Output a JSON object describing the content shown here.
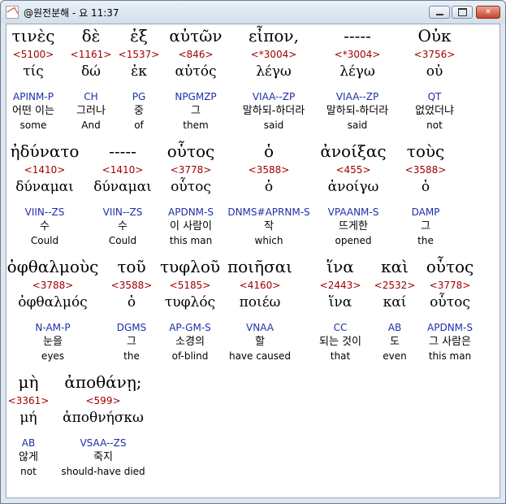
{
  "window": {
    "title": "@원전분해 - 요 11:37",
    "icon": "app-icon"
  },
  "rows": [
    {
      "words": [
        {
          "greek": "τινὲς",
          "strong": "<5100>",
          "lemma": "τίς",
          "parse": "APINM-P",
          "korean": "어떤 이는",
          "english": "some"
        },
        {
          "greek": "δὲ",
          "strong": "<1161>",
          "lemma": "δώ",
          "parse": "CH",
          "korean": "그러나",
          "english": "And"
        },
        {
          "greek": "ἐξ",
          "strong": "<1537>",
          "lemma": "ἐκ",
          "parse": "PG",
          "korean": "중",
          "english": "of"
        },
        {
          "greek": "αὐτῶν",
          "strong": "<846>",
          "lemma": "αὐτός",
          "parse": "NPGMZP",
          "korean": "그",
          "english": "them"
        },
        {
          "greek": "εἶπον,",
          "strong": "<*3004>",
          "lemma": "λέγω",
          "parse": "VIAA--ZP",
          "korean": "말하되-하더라",
          "english": "said"
        },
        {
          "greek": "-----",
          "strong": "<*3004>",
          "lemma": "λέγω",
          "parse": "VIAA--ZP",
          "korean": "말하되-하더라",
          "english": "said"
        },
        {
          "greek": "Οὐκ",
          "strong": "<3756>",
          "lemma": "οὐ",
          "parse": "QT",
          "korean": "없었더냐",
          "english": "not"
        }
      ]
    },
    {
      "words": [
        {
          "greek": "ἠδύνατο",
          "strong": "<1410>",
          "lemma": "δύναμαι",
          "parse": "VIIN--ZS",
          "korean": "수",
          "english": "Could"
        },
        {
          "greek": "-----",
          "strong": "<1410>",
          "lemma": "δύναμαι",
          "parse": "VIIN--ZS",
          "korean": "수",
          "english": "Could"
        },
        {
          "greek": "οὗτος",
          "strong": "<3778>",
          "lemma": "οὗτος",
          "parse": "APDNM-S",
          "korean": "이 사람이",
          "english": "this man"
        },
        {
          "greek": "ὁ",
          "strong": "<3588>",
          "lemma": "ὁ",
          "parse": "DNMS#APRNM-S",
          "korean": "작",
          "english": "which"
        },
        {
          "greek": "ἀνοίξας",
          "strong": "<455>",
          "lemma": "ἀνοίγω",
          "parse": "VPAANM-S",
          "korean": "뜨게한",
          "english": "opened"
        },
        {
          "greek": "τοὺς",
          "strong": "<3588>",
          "lemma": "ὁ",
          "parse": "DAMP",
          "korean": "그",
          "english": "the"
        }
      ]
    },
    {
      "words": [
        {
          "greek": "ὀφθαλμοὺς",
          "strong": "<3788>",
          "lemma": "ὀφθαλμός",
          "parse": "N-AM-P",
          "korean": "눈을",
          "english": "eyes"
        },
        {
          "greek": "τοῦ",
          "strong": "<3588>",
          "lemma": "ὁ",
          "parse": "DGMS",
          "korean": "그",
          "english": "the"
        },
        {
          "greek": "τυφλοῦ",
          "strong": "<5185>",
          "lemma": "τυφλός",
          "parse": "AP-GM-S",
          "korean": "소경의",
          "english": "of-blind"
        },
        {
          "greek": "ποιῆσαι",
          "strong": "<4160>",
          "lemma": "ποιέω",
          "parse": "VNAA",
          "korean": "할",
          "english": "have caused"
        },
        {
          "greek": "ἵνα",
          "strong": "<2443>",
          "lemma": "ἵνα",
          "parse": "CC",
          "korean": "되는 것이",
          "english": "that"
        },
        {
          "greek": "καὶ",
          "strong": "<2532>",
          "lemma": "καί",
          "parse": "AB",
          "korean": "도",
          "english": "even"
        },
        {
          "greek": "οὗτος",
          "strong": "<3778>",
          "lemma": "οὗτος",
          "parse": "APDNM-S",
          "korean": "그 사람은",
          "english": "this man"
        }
      ]
    },
    {
      "words": [
        {
          "greek": "μὴ",
          "strong": "<3361>",
          "lemma": "μή",
          "parse": "AB",
          "korean": "않게",
          "english": "not"
        },
        {
          "greek": "ἀποθάνῃ;",
          "strong": "<599>",
          "lemma": "ἀποθνήσκω",
          "parse": "VSAA--ZS",
          "korean": "죽지",
          "english": "should-have died"
        }
      ]
    }
  ]
}
